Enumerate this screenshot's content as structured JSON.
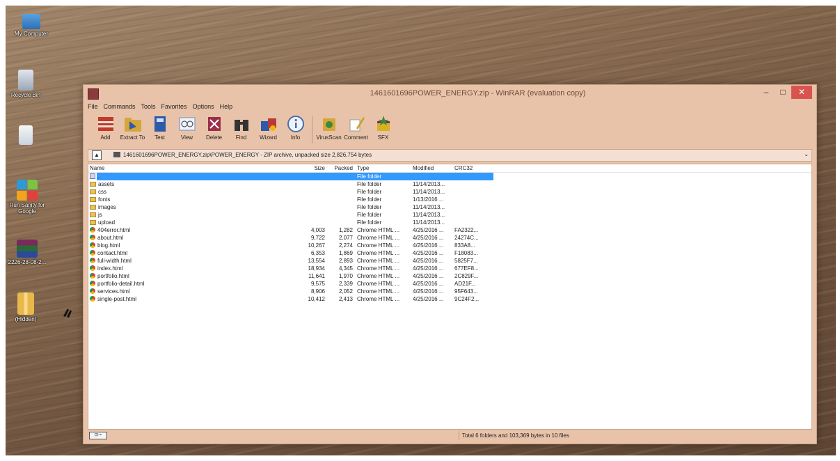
{
  "desktop": {
    "icons": [
      {
        "label": "My Computer",
        "icon": "computer-icon"
      },
      {
        "label": "Recycle Bin",
        "icon": "recycle-bin-icon"
      },
      {
        "label": "",
        "icon": "file-icon"
      },
      {
        "label": "Run Sanity for Google",
        "icon": "tiles-icon"
      },
      {
        "label": "2226-28-08-2...",
        "icon": "winrar-icon"
      },
      {
        "label": "(Hidden)",
        "icon": "zip-folder-icon"
      }
    ]
  },
  "window": {
    "title": "1461601696POWER_ENERGY.zip - WinRAR (evaluation copy)",
    "buttons": {
      "minimize": "–",
      "maximize": "□",
      "close": "✕"
    }
  },
  "menu": [
    "File",
    "Commands",
    "Tools",
    "Favorites",
    "Options",
    "Help"
  ],
  "toolbar": [
    {
      "label": "Add",
      "icon": "add-archive-icon",
      "color": "#c0392b"
    },
    {
      "label": "Extract To",
      "icon": "extract-folder-icon",
      "color": "#d4a63c"
    },
    {
      "label": "Test",
      "icon": "test-book-icon",
      "color": "#2e5aa8"
    },
    {
      "label": "View",
      "icon": "view-glasses-icon",
      "color": "#6a8fc4"
    },
    {
      "label": "Delete",
      "icon": "delete-icon",
      "color": "#9b2f4a"
    },
    {
      "label": "Find",
      "icon": "find-binoculars-icon",
      "color": "#333333"
    },
    {
      "label": "Wizard",
      "icon": "wizard-icon",
      "color": "#b73a3a"
    },
    {
      "label": "Info",
      "icon": "info-icon",
      "color": "#4a6fa5"
    },
    {
      "label": "VirusScan",
      "icon": "virus-scan-icon",
      "color": "#3b8a3b"
    },
    {
      "label": "Comment",
      "icon": "comment-pencil-icon",
      "color": "#c9a32a"
    },
    {
      "label": "SFX",
      "icon": "sfx-box-icon",
      "color": "#d8b020"
    }
  ],
  "address": {
    "path": "1461601696POWER_ENERGY.zip\\POWER_ENERGY - ZIP archive, unpacked size 2,826,754 bytes",
    "dropdown": "⌄"
  },
  "columns": {
    "name": "Name",
    "size": "Size",
    "packed": "Packed",
    "type": "Type",
    "modified": "Modified",
    "crc": "CRC32"
  },
  "rows": [
    {
      "name": "..",
      "size": "",
      "packed": "",
      "type": "File folder",
      "modified": "",
      "crc": "",
      "icon": "updir",
      "selected": true
    },
    {
      "name": "assets",
      "size": "",
      "packed": "",
      "type": "File folder",
      "modified": "11/14/2013...",
      "crc": "",
      "icon": "folder"
    },
    {
      "name": "css",
      "size": "",
      "packed": "",
      "type": "File folder",
      "modified": "11/14/2013...",
      "crc": "",
      "icon": "folder"
    },
    {
      "name": "fonts",
      "size": "",
      "packed": "",
      "type": "File folder",
      "modified": "1/13/2016 ...",
      "crc": "",
      "icon": "folder"
    },
    {
      "name": "images",
      "size": "",
      "packed": "",
      "type": "File folder",
      "modified": "11/14/2013...",
      "crc": "",
      "icon": "folder"
    },
    {
      "name": "js",
      "size": "",
      "packed": "",
      "type": "File folder",
      "modified": "11/14/2013...",
      "crc": "",
      "icon": "folder"
    },
    {
      "name": "upload",
      "size": "",
      "packed": "",
      "type": "File folder",
      "modified": "11/14/2013...",
      "crc": "",
      "icon": "folder"
    },
    {
      "name": "404error.html",
      "size": "4,003",
      "packed": "1,282",
      "type": "Chrome HTML ...",
      "modified": "4/25/2016 ...",
      "crc": "FA2322...",
      "icon": "chrome"
    },
    {
      "name": "about.html",
      "size": "9,722",
      "packed": "2,077",
      "type": "Chrome HTML ...",
      "modified": "4/25/2016 ...",
      "crc": "24274C...",
      "icon": "chrome"
    },
    {
      "name": "blog.html",
      "size": "10,267",
      "packed": "2,274",
      "type": "Chrome HTML ...",
      "modified": "4/25/2016 ...",
      "crc": "833A8...",
      "icon": "chrome"
    },
    {
      "name": "contact.html",
      "size": "6,353",
      "packed": "1,869",
      "type": "Chrome HTML ...",
      "modified": "4/25/2016 ...",
      "crc": "F18083...",
      "icon": "chrome"
    },
    {
      "name": "full-width.html",
      "size": "13,554",
      "packed": "2,893",
      "type": "Chrome HTML ...",
      "modified": "4/25/2016 ...",
      "crc": "5825F7...",
      "icon": "chrome"
    },
    {
      "name": "index.html",
      "size": "18,934",
      "packed": "4,345",
      "type": "Chrome HTML ...",
      "modified": "4/25/2016 ...",
      "crc": "677EF8...",
      "icon": "chrome"
    },
    {
      "name": "portfolio.html",
      "size": "11,641",
      "packed": "1,970",
      "type": "Chrome HTML ...",
      "modified": "4/25/2016 ...",
      "crc": "2C829F...",
      "icon": "chrome"
    },
    {
      "name": "portfolio-detail.html",
      "size": "9,575",
      "packed": "2,339",
      "type": "Chrome HTML ...",
      "modified": "4/25/2016 ...",
      "crc": "AD21F...",
      "icon": "chrome"
    },
    {
      "name": "services.html",
      "size": "8,906",
      "packed": "2,052",
      "type": "Chrome HTML ...",
      "modified": "4/25/2016 ...",
      "crc": "95F643...",
      "icon": "chrome"
    },
    {
      "name": "single-post.html",
      "size": "10,412",
      "packed": "2,413",
      "type": "Chrome HTML ...",
      "modified": "4/25/2016 ...",
      "crc": "9C24F2...",
      "icon": "chrome"
    }
  ],
  "status": {
    "keys_icon": "keys-icon",
    "total": "Total 6 folders and 103,369 bytes in 10 files"
  },
  "colors": {
    "titlebar": "#e9c3a9",
    "selection": "#3399ff",
    "close": "#d9534f"
  }
}
